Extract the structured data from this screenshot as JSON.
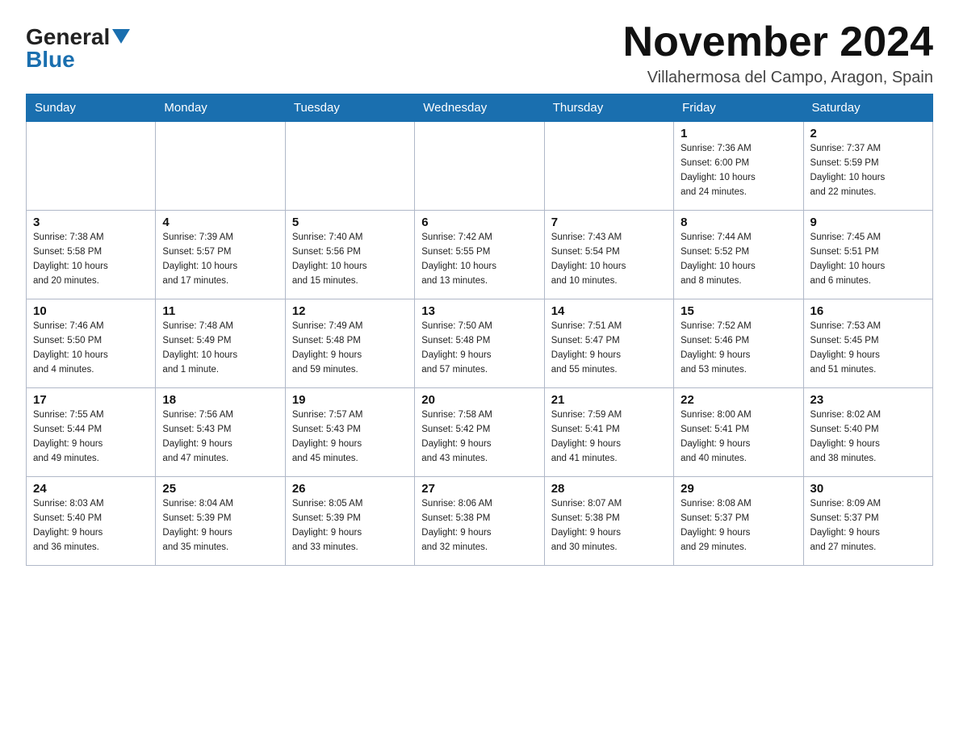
{
  "logo": {
    "general": "General",
    "blue": "Blue"
  },
  "header": {
    "month_year": "November 2024",
    "location": "Villahermosa del Campo, Aragon, Spain"
  },
  "weekdays": [
    "Sunday",
    "Monday",
    "Tuesday",
    "Wednesday",
    "Thursday",
    "Friday",
    "Saturday"
  ],
  "weeks": [
    [
      {
        "day": "",
        "info": ""
      },
      {
        "day": "",
        "info": ""
      },
      {
        "day": "",
        "info": ""
      },
      {
        "day": "",
        "info": ""
      },
      {
        "day": "",
        "info": ""
      },
      {
        "day": "1",
        "info": "Sunrise: 7:36 AM\nSunset: 6:00 PM\nDaylight: 10 hours\nand 24 minutes."
      },
      {
        "day": "2",
        "info": "Sunrise: 7:37 AM\nSunset: 5:59 PM\nDaylight: 10 hours\nand 22 minutes."
      }
    ],
    [
      {
        "day": "3",
        "info": "Sunrise: 7:38 AM\nSunset: 5:58 PM\nDaylight: 10 hours\nand 20 minutes."
      },
      {
        "day": "4",
        "info": "Sunrise: 7:39 AM\nSunset: 5:57 PM\nDaylight: 10 hours\nand 17 minutes."
      },
      {
        "day": "5",
        "info": "Sunrise: 7:40 AM\nSunset: 5:56 PM\nDaylight: 10 hours\nand 15 minutes."
      },
      {
        "day": "6",
        "info": "Sunrise: 7:42 AM\nSunset: 5:55 PM\nDaylight: 10 hours\nand 13 minutes."
      },
      {
        "day": "7",
        "info": "Sunrise: 7:43 AM\nSunset: 5:54 PM\nDaylight: 10 hours\nand 10 minutes."
      },
      {
        "day": "8",
        "info": "Sunrise: 7:44 AM\nSunset: 5:52 PM\nDaylight: 10 hours\nand 8 minutes."
      },
      {
        "day": "9",
        "info": "Sunrise: 7:45 AM\nSunset: 5:51 PM\nDaylight: 10 hours\nand 6 minutes."
      }
    ],
    [
      {
        "day": "10",
        "info": "Sunrise: 7:46 AM\nSunset: 5:50 PM\nDaylight: 10 hours\nand 4 minutes."
      },
      {
        "day": "11",
        "info": "Sunrise: 7:48 AM\nSunset: 5:49 PM\nDaylight: 10 hours\nand 1 minute."
      },
      {
        "day": "12",
        "info": "Sunrise: 7:49 AM\nSunset: 5:48 PM\nDaylight: 9 hours\nand 59 minutes."
      },
      {
        "day": "13",
        "info": "Sunrise: 7:50 AM\nSunset: 5:48 PM\nDaylight: 9 hours\nand 57 minutes."
      },
      {
        "day": "14",
        "info": "Sunrise: 7:51 AM\nSunset: 5:47 PM\nDaylight: 9 hours\nand 55 minutes."
      },
      {
        "day": "15",
        "info": "Sunrise: 7:52 AM\nSunset: 5:46 PM\nDaylight: 9 hours\nand 53 minutes."
      },
      {
        "day": "16",
        "info": "Sunrise: 7:53 AM\nSunset: 5:45 PM\nDaylight: 9 hours\nand 51 minutes."
      }
    ],
    [
      {
        "day": "17",
        "info": "Sunrise: 7:55 AM\nSunset: 5:44 PM\nDaylight: 9 hours\nand 49 minutes."
      },
      {
        "day": "18",
        "info": "Sunrise: 7:56 AM\nSunset: 5:43 PM\nDaylight: 9 hours\nand 47 minutes."
      },
      {
        "day": "19",
        "info": "Sunrise: 7:57 AM\nSunset: 5:43 PM\nDaylight: 9 hours\nand 45 minutes."
      },
      {
        "day": "20",
        "info": "Sunrise: 7:58 AM\nSunset: 5:42 PM\nDaylight: 9 hours\nand 43 minutes."
      },
      {
        "day": "21",
        "info": "Sunrise: 7:59 AM\nSunset: 5:41 PM\nDaylight: 9 hours\nand 41 minutes."
      },
      {
        "day": "22",
        "info": "Sunrise: 8:00 AM\nSunset: 5:41 PM\nDaylight: 9 hours\nand 40 minutes."
      },
      {
        "day": "23",
        "info": "Sunrise: 8:02 AM\nSunset: 5:40 PM\nDaylight: 9 hours\nand 38 minutes."
      }
    ],
    [
      {
        "day": "24",
        "info": "Sunrise: 8:03 AM\nSunset: 5:40 PM\nDaylight: 9 hours\nand 36 minutes."
      },
      {
        "day": "25",
        "info": "Sunrise: 8:04 AM\nSunset: 5:39 PM\nDaylight: 9 hours\nand 35 minutes."
      },
      {
        "day": "26",
        "info": "Sunrise: 8:05 AM\nSunset: 5:39 PM\nDaylight: 9 hours\nand 33 minutes."
      },
      {
        "day": "27",
        "info": "Sunrise: 8:06 AM\nSunset: 5:38 PM\nDaylight: 9 hours\nand 32 minutes."
      },
      {
        "day": "28",
        "info": "Sunrise: 8:07 AM\nSunset: 5:38 PM\nDaylight: 9 hours\nand 30 minutes."
      },
      {
        "day": "29",
        "info": "Sunrise: 8:08 AM\nSunset: 5:37 PM\nDaylight: 9 hours\nand 29 minutes."
      },
      {
        "day": "30",
        "info": "Sunrise: 8:09 AM\nSunset: 5:37 PM\nDaylight: 9 hours\nand 27 minutes."
      }
    ]
  ]
}
